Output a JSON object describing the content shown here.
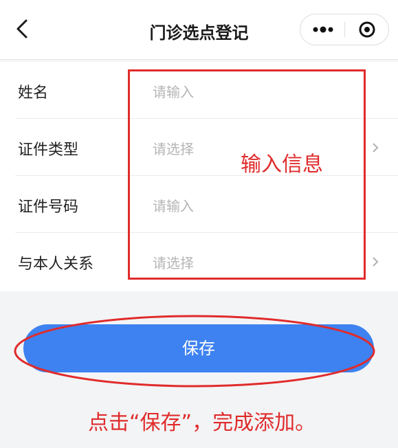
{
  "nav": {
    "title": "门诊选点登记",
    "back_icon": "chevron-left-icon",
    "more_icon": "more-dots-icon",
    "close_icon": "target-circle-icon"
  },
  "form": {
    "rows": [
      {
        "label": "姓名",
        "placeholder": "请输入",
        "type": "input"
      },
      {
        "label": "证件类型",
        "placeholder": "请选择",
        "type": "select"
      },
      {
        "label": "证件号码",
        "placeholder": "请输入",
        "type": "input"
      },
      {
        "label": "与本人关系",
        "placeholder": "请选择",
        "type": "select"
      }
    ]
  },
  "save_button": {
    "label": "保存"
  },
  "annotations": {
    "input_info": "输入信息",
    "bottom_note": "点击“保存”，完成添加。",
    "highlight_color": "#e02b2b"
  },
  "colors": {
    "primary": "#3d82f0",
    "background": "#f3f4f6",
    "placeholder": "#b5b5b5"
  }
}
